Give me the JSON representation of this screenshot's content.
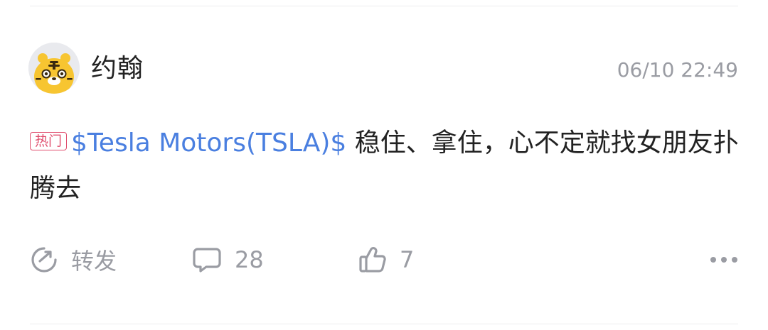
{
  "post": {
    "author": "约翰",
    "timestamp": "06/10 22:49",
    "badge": "热门",
    "stock_tag": "$Tesla Motors(TSLA)$",
    "text": " 稳住、拿住，心不定就找女朋友扑腾去"
  },
  "actions": {
    "repost_label": "转发",
    "comment_count": "28",
    "like_count": "7"
  },
  "colors": {
    "link": "#4a7fe0",
    "badge": "#e04d6d",
    "muted": "#9a9ca3",
    "avatar_face": "#f7c531"
  },
  "icons": {
    "avatar": "tiger-avatar",
    "repost": "repost-icon",
    "comment": "comment-icon",
    "like": "thumbs-up-icon",
    "more": "more-icon"
  }
}
